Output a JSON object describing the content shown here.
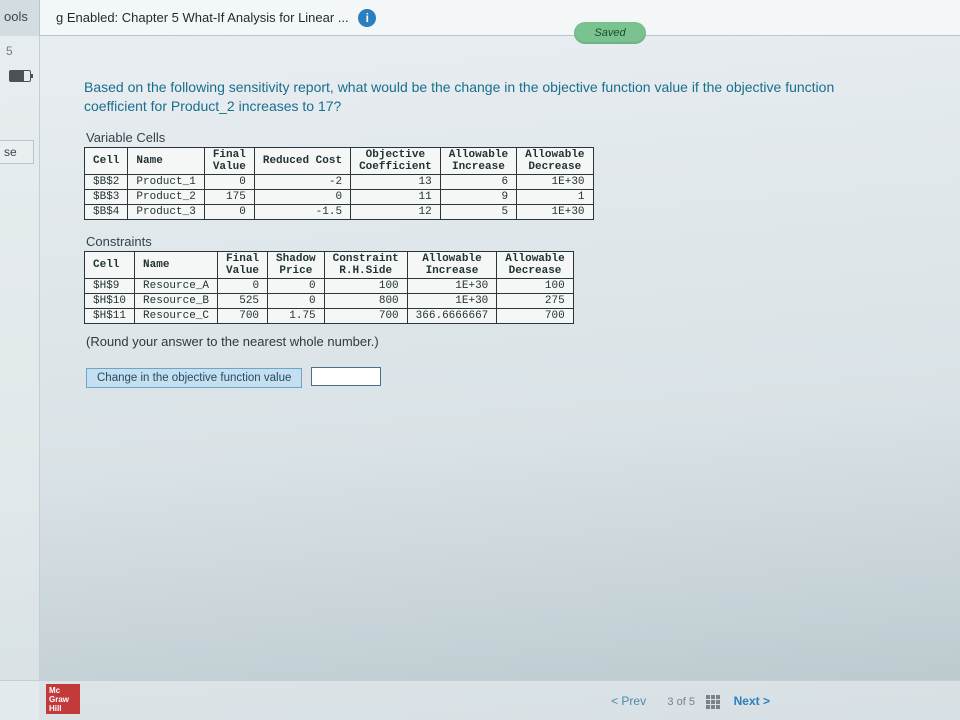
{
  "top": {
    "tools_tab": "ools",
    "title": "g Enabled: Chapter 5 What-If Analysis for Linear ...",
    "info_glyph": "i",
    "saved": "Saved"
  },
  "rail": {
    "num": "5",
    "se_tab": "se"
  },
  "question": "Based on the following sensitivity report, what would be the change in the objective function value if the objective function coefficient for Product_2 increases to 17?",
  "var_section": "Variable Cells",
  "var_headers": {
    "cell": "Cell",
    "name": "Name",
    "final": "Final\nValue",
    "reduced": "Reduced Cost",
    "obj": "Objective\nCoefficient",
    "inc": "Allowable\nIncrease",
    "dec": "Allowable\nDecrease"
  },
  "var_rows": [
    {
      "cell": "$B$2",
      "name": "Product_1",
      "final": "0",
      "reduced": "-2",
      "obj": "13",
      "inc": "6",
      "dec": "1E+30"
    },
    {
      "cell": "$B$3",
      "name": "Product_2",
      "final": "175",
      "reduced": "0",
      "obj": "11",
      "inc": "9",
      "dec": "1"
    },
    {
      "cell": "$B$4",
      "name": "Product_3",
      "final": "0",
      "reduced": "-1.5",
      "obj": "12",
      "inc": "5",
      "dec": "1E+30"
    }
  ],
  "con_section": "Constraints",
  "con_headers": {
    "cell": "Cell",
    "name": "Name",
    "final": "Final\nValue",
    "shadow": "Shadow\nPrice",
    "rhs": "Constraint\nR.H.Side",
    "inc": "Allowable\nIncrease",
    "dec": "Allowable\nDecrease"
  },
  "con_rows": [
    {
      "cell": "$H$9",
      "name": "Resource_A",
      "final": "0",
      "shadow": "0",
      "rhs": "100",
      "inc": "1E+30",
      "dec": "100"
    },
    {
      "cell": "$H$10",
      "name": "Resource_B",
      "final": "525",
      "shadow": "0",
      "rhs": "800",
      "inc": "1E+30",
      "dec": "275"
    },
    {
      "cell": "$H$11",
      "name": "Resource_C",
      "final": "700",
      "shadow": "1.75",
      "rhs": "700",
      "inc": "366.6666667",
      "dec": "700"
    }
  ],
  "round_note": "(Round your answer to the nearest whole number.)",
  "answer_label": "Change in the objective function value",
  "logo": "Mc\nGraw\nHill",
  "nav": {
    "prev": "<  Prev",
    "page": "3 of 5",
    "next": "Next  >"
  }
}
